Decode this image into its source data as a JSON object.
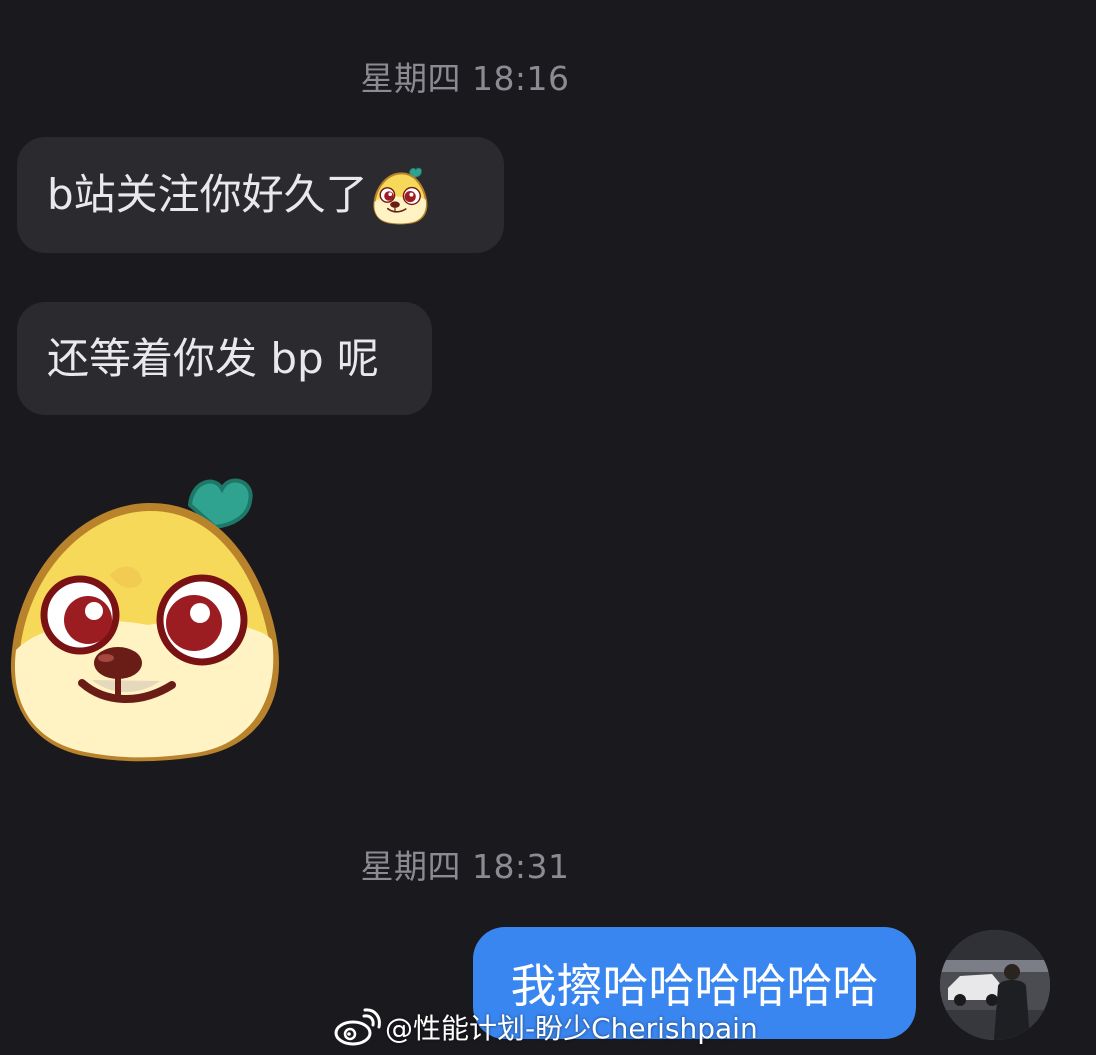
{
  "chat": {
    "timestamp_1": "星期四 18:16",
    "message_1": "b站关注你好久了",
    "message_1_emoji": "shiba-mango-emoji",
    "message_2": "还等着你发 bp 呢",
    "sticker": "shiba-mango-sticker",
    "timestamp_2": "星期四 18:31",
    "message_3": "我擦哈哈哈哈哈哈"
  },
  "watermark": {
    "text": "@性能计划-盼少Cherishpain",
    "logo": "weibo-logo"
  },
  "colors": {
    "background": "#1a191e",
    "incoming_bubble": "#2b2a2f",
    "outgoing_bubble": "#3a86f0",
    "timestamp_text": "#8b8b91"
  }
}
